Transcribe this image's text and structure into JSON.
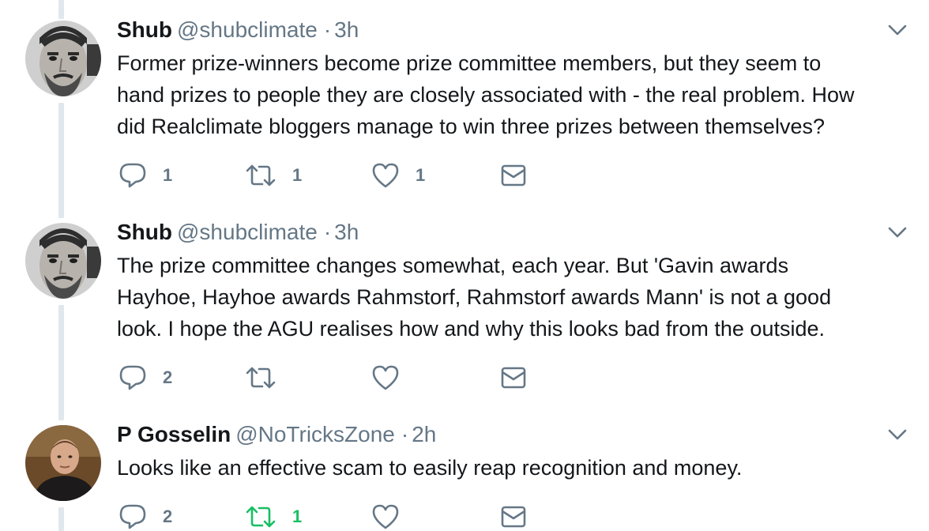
{
  "thread": {
    "tweets": [
      {
        "author_name": "Shub",
        "handle": "@shubclimate",
        "separator": "·",
        "time": "3h",
        "avatar_icon": "avatar-bearded-man-bw",
        "text": "Former prize-winners become prize committee members, but they seem to\nhand prizes to people they are closely associated with - the real problem. How\ndid Realclimate bloggers manage to win three prizes between themselves?",
        "replies": "1",
        "retweets": "1",
        "likes": "1",
        "retweeted": false
      },
      {
        "author_name": "Shub",
        "handle": "@shubclimate",
        "separator": "·",
        "time": "3h",
        "avatar_icon": "avatar-bearded-man-bw",
        "text": "The prize committee changes somewhat, each year. But 'Gavin awards\nHayhoe, Hayhoe awards Rahmstorf, Rahmstorf awards Mann' is not a good\nlook. I hope the AGU realises how and why this looks bad from the outside.",
        "replies": "2",
        "retweets": "",
        "likes": "",
        "retweeted": false
      },
      {
        "author_name": "P Gosselin",
        "handle": "@NoTricksZone",
        "separator": "·",
        "time": "2h",
        "avatar_icon": "avatar-man-color",
        "text": "Looks like an effective scam to easily reap recognition and money.",
        "replies": "2",
        "retweets": "1",
        "likes": "",
        "retweeted": true
      }
    ]
  },
  "icons": {
    "reply": "reply-bubble-icon",
    "retweet": "retweet-icon",
    "like": "heart-icon",
    "dm": "envelope-icon",
    "more": "chevron-down-icon"
  },
  "colors": {
    "text": "#14171a",
    "muted": "#657786",
    "retweet_active": "#17bf63",
    "thread_line": "#e1e8ed"
  }
}
